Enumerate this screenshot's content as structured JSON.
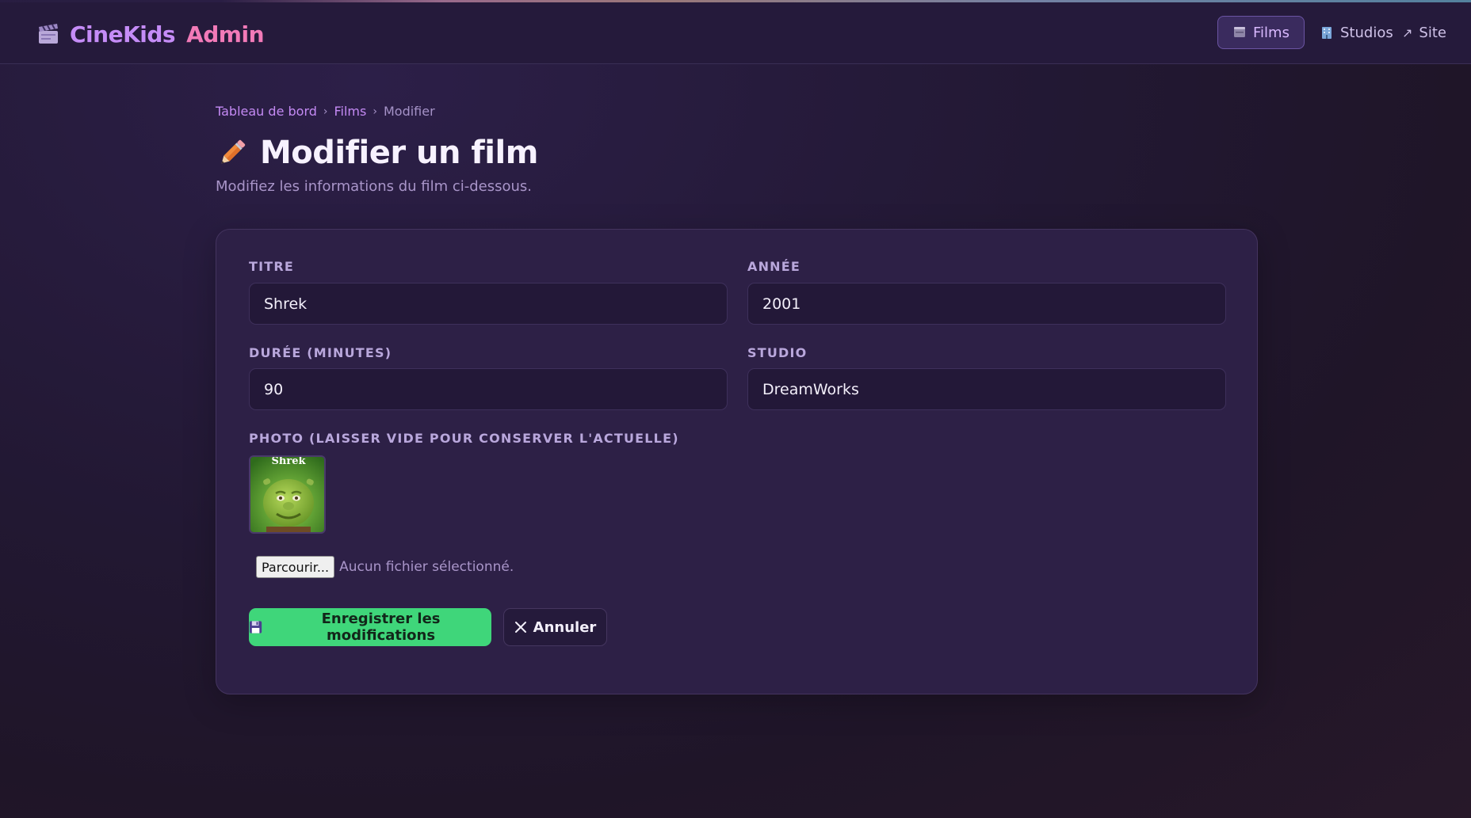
{
  "brand": {
    "name_part1": "CineKids",
    "name_part2": "Admin",
    "icon": "clapperboard-icon",
    "colors": {
      "cine": "#c58cf7",
      "admin": "#f27ab8"
    }
  },
  "nav": {
    "items": [
      {
        "label": "Films",
        "icon": "film-icon",
        "active": true
      },
      {
        "label": "Studios",
        "icon": "building-icon",
        "active": false
      },
      {
        "label": "Site",
        "icon": "external-link-icon",
        "active": false
      }
    ]
  },
  "breadcrumb": {
    "items": [
      "Tableau de bord",
      "Films",
      "Modifier"
    ]
  },
  "page": {
    "title": "Modifier un film",
    "title_icon": "pencil-icon",
    "subtitle": "Modifiez les informations du film ci-dessous."
  },
  "form": {
    "titre": {
      "label": "Titre",
      "value": "Shrek"
    },
    "annee": {
      "label": "Année",
      "value": "2001"
    },
    "duree": {
      "label": "Durée (minutes)",
      "value": "90"
    },
    "studio": {
      "label": "Studio",
      "value": "DreamWorks"
    },
    "photo": {
      "label": "Photo (laisser vide pour conserver l'actuelle)",
      "poster_caption": "Shrek",
      "browse_label": "Parcourir...",
      "status": "Aucun fichier sélectionné."
    },
    "save_label": "Enregistrer les modifications",
    "save_icon": "floppy-disk-icon",
    "cancel_label": "Annuler",
    "cancel_icon": "close-icon"
  },
  "colors": {
    "accent_green": "#3fd67a",
    "accent_purple": "#c48af4",
    "card_bg": "#2d2046"
  }
}
